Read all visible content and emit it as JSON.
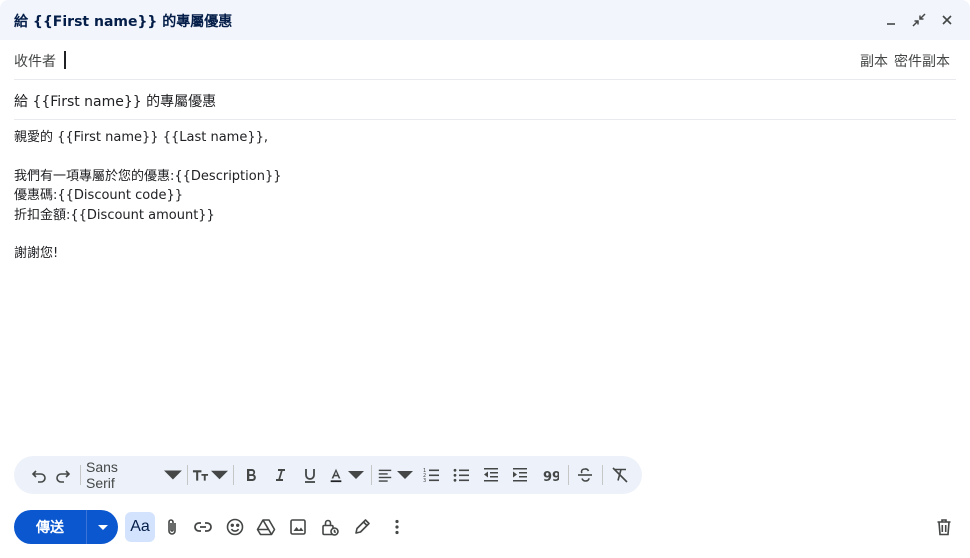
{
  "window": {
    "title": "給 {{First name}} 的專屬優惠",
    "buttons": [
      "minimize-icon",
      "exit-fullscreen-icon",
      "close-icon"
    ]
  },
  "recipients": {
    "to_label": "收件者",
    "cc_label": "副本",
    "bcc_label": "密件副本"
  },
  "subject": "給 {{First name}} 的專屬優惠",
  "body": {
    "greeting": "親愛的 {{First name}} {{Last name}},",
    "line1": "我們有一項專屬於您的優惠:{{Description}}",
    "line2": "優惠碼:{{Discount code}}",
    "line3": "折扣金額:{{Discount amount}}",
    "closing": "謝謝您!"
  },
  "format_toolbar": {
    "font": "Sans Serif",
    "icons": [
      "undo-icon",
      "redo-icon",
      "font-size-icon",
      "bold-icon",
      "italic-icon",
      "underline-icon",
      "text-color-icon",
      "align-icon",
      "numbered-list-icon",
      "bulleted-list-icon",
      "indent-less-icon",
      "indent-more-icon",
      "quote-icon",
      "strikethrough-icon",
      "clear-formatting-icon"
    ]
  },
  "bottom_toolbar": {
    "send_label": "傳送",
    "format_label": "Aa",
    "icons": [
      "attach-icon",
      "link-icon",
      "emoji-icon",
      "drive-icon",
      "photo-icon",
      "confidential-icon",
      "signature-icon",
      "more-options-icon",
      "delete-icon"
    ]
  },
  "colors": {
    "send_button": "#0b57d0",
    "titlebar": "#f2f6fc",
    "toolbar_bg": "#edf2fa",
    "aa_active": "#d3e3fd"
  }
}
